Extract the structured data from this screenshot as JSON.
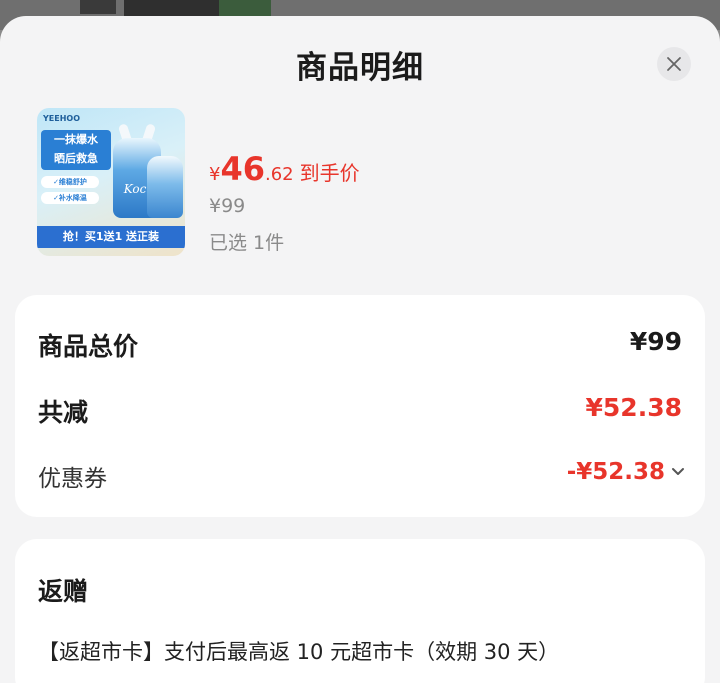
{
  "sheet": {
    "title": "商品明细"
  },
  "product": {
    "image_texts": {
      "brand": "YEEHOO",
      "slogan_line1": "一抹爆水",
      "slogan_line2": "晒后救急",
      "tag1": "✓维稳舒护",
      "tag2": "✓补水降温",
      "bottle_label": "Koci",
      "banner": "抢！买1送1 送正装"
    },
    "price": {
      "currency": "¥",
      "integer": "46",
      "decimal": ".62",
      "label": "到手价"
    },
    "original_price": "¥99",
    "selected": "已选 1件"
  },
  "summary": {
    "total_label": "商品总价",
    "total_value": "¥99",
    "reduce_label": "共减",
    "reduce_value": "¥52.38",
    "coupon_label": "优惠券",
    "coupon_value": "-¥52.38"
  },
  "gift": {
    "title": "返赠",
    "text": "【返超市卡】支付后最高返 10 元超市卡（效期 30 天）"
  },
  "colors": {
    "accent_red": "#e8352b",
    "sheet_bg": "#f4f4f5",
    "card_bg": "#ffffff"
  },
  "icons": {
    "close": "close-icon",
    "chevron": "chevron-down-icon"
  }
}
